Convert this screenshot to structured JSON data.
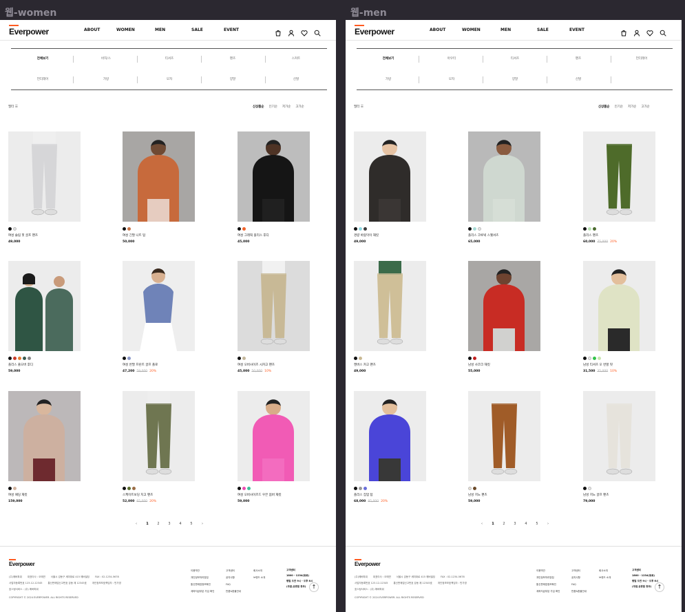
{
  "frames": [
    {
      "label": "웹-women",
      "categories_row1": [
        "전체보기",
        "바지/스",
        "티셔츠",
        "팬츠",
        "스커트"
      ],
      "categories_row2": [
        "언더레어",
        "가방",
        "모자",
        "양말",
        "신발"
      ],
      "products": [
        {
          "name": "여성 슬림 핏 골프 팬츠",
          "price": "49,000",
          "orig": "",
          "disc": "",
          "colors": [
            "#111111",
            "#e3e3e3"
          ],
          "bg": "#ececec",
          "fig": "pants",
          "c1": "#d6d6d8",
          "c2": "#efefef",
          "skin": "#e9c7a9"
        },
        {
          "name": "여성 긴팔 니트 탑",
          "price": "50,000",
          "orig": "",
          "disc": "",
          "colors": [
            "#111111",
            "#c8764a"
          ],
          "bg": "#a8a6a4",
          "fig": "top",
          "c1": "#c76a3c",
          "c2": "#e6ccc0",
          "skin": "#6f4a34"
        },
        {
          "name": "여성 그래픽 플리스 후디",
          "price": "45,000",
          "orig": "",
          "disc": "",
          "colors": [
            "#111111",
            "#f2632a"
          ],
          "bg": "#bdbdbd",
          "fig": "top",
          "c1": "#151515",
          "c2": "#202020",
          "skin": "#4e3325"
        },
        {
          "name": "플리스 풀오버 후디",
          "price": "59,000",
          "orig": "",
          "disc": "",
          "colors": [
            "#111111",
            "#c93b2b",
            "#e57e33",
            "#3a5a4e",
            "#888888"
          ],
          "bg": "#ececec",
          "fig": "duo",
          "c1": "#2f5544",
          "c2": "#23302c",
          "skin": "#d9b596"
        },
        {
          "name": "여성 반팔 프린트 골프 폴로",
          "price": "47,200",
          "orig": "59,000",
          "disc": "20%",
          "colors": [
            "#111111",
            "#8a98c8"
          ],
          "bg": "#eeeeee",
          "fig": "polo",
          "c1": "#6f83b8",
          "c2": "#ffffff",
          "skin": "#d8b090"
        },
        {
          "name": "여성 오버사이즈 시카고 팬츠",
          "price": "45,000",
          "orig": "50,000",
          "disc": "10%",
          "colors": [
            "#111111",
            "#c4b79c"
          ],
          "bg": "#dcdcdc",
          "fig": "pants",
          "c1": "#c8b996",
          "c2": "#f1f1f1",
          "skin": "#4e3325"
        },
        {
          "name": "여성 패딩 재킷",
          "price": "159,000",
          "orig": "",
          "disc": "",
          "colors": [
            "#111111",
            "#d4b6a2"
          ],
          "bg": "#bcb8b9",
          "fig": "top",
          "c1": "#cdb0a0",
          "c2": "#6e2a2f",
          "skin": "#d9b79d"
        },
        {
          "name": "스케이트보딩 치고 팬츠",
          "price": "52,000",
          "orig": "65,000",
          "disc": "20%",
          "colors": [
            "#111111",
            "#5a6d2e",
            "#9b6d46"
          ],
          "bg": "#ececec",
          "fig": "pants",
          "c1": "#6f7651",
          "c2": "#eeeeee",
          "skin": "#b98462"
        },
        {
          "name": "여성 오버사이즈드 우븐 봄버 재킷",
          "price": "59,000",
          "orig": "",
          "disc": "",
          "colors": [
            "#111111",
            "#ea4bb0",
            "#3fbf9a"
          ],
          "bg": "#ececec",
          "fig": "top",
          "c1": "#f15bb5",
          "c2": "#f36cbf",
          "skin": "#d8ac88"
        }
      ]
    },
    {
      "label": "웹-men",
      "categories_row1": [
        "전체보기",
        "아우터",
        "티셔츠",
        "팬츠",
        "언더레어"
      ],
      "categories_row2": [
        "가방",
        "모자",
        "양말",
        "신발",
        ""
      ],
      "products": [
        {
          "name": "경량 바람막이 재킷",
          "price": "49,000",
          "orig": "",
          "disc": "",
          "colors": [
            "#111111",
            "#8fd8e2",
            "#3c3c3c"
          ],
          "bg": "#ececec",
          "fig": "top",
          "c1": "#2f2c2a",
          "c2": "#3a3634",
          "skin": "#e6c3a4"
        },
        {
          "name": "플리스 크루넥 스웻셔츠",
          "price": "65,000",
          "orig": "",
          "disc": "",
          "colors": [
            "#111111",
            "#a9dcd7",
            "#e8e8e8"
          ],
          "bg": "#b9b9b9",
          "fig": "top",
          "c1": "#cfd8d0",
          "c2": "#d6ded6",
          "skin": "#8a5b3f"
        },
        {
          "name": "플리스 팬츠",
          "price": "60,000",
          "orig": "75,000",
          "disc": "20%",
          "colors": [
            "#111111",
            "#b8e2b2",
            "#4d6b30"
          ],
          "bg": "#ececec",
          "fig": "pants",
          "c1": "#4e6b2a",
          "c2": "#ececec",
          "skin": "#6f4a34"
        },
        {
          "name": "캔버스 카고 팬츠",
          "price": "49,000",
          "orig": "",
          "disc": "",
          "colors": [
            "#111111",
            "#c9b993"
          ],
          "bg": "#ececec",
          "fig": "pants",
          "c1": "#cfbf98",
          "c2": "#3b6b4a",
          "skin": "#e1b896"
        },
        {
          "name": "남성 사코크 재킷",
          "price": "55,000",
          "orig": "",
          "disc": "",
          "colors": [
            "#111111",
            "#c21f1f"
          ],
          "bg": "#a9a7a5",
          "fig": "top",
          "c1": "#c82c24",
          "c2": "#d1d1cf",
          "skin": "#6e4330"
        },
        {
          "name": "남성 티셔츠 오 번할 핏",
          "price": "31,500",
          "orig": "35,000",
          "disc": "10%",
          "colors": [
            "#111111",
            "#e8e8e8",
            "#33c24a",
            "#c8e6b0"
          ],
          "bg": "#ececec",
          "fig": "top",
          "c1": "#dfe3c5",
          "c2": "#2a2a2a",
          "skin": "#e3bf9c"
        },
        {
          "name": "플리스 집업 탑",
          "price": "68,000",
          "orig": "85,000",
          "disc": "20%",
          "colors": [
            "#111111",
            "#999999",
            "#6a6fd8"
          ],
          "bg": "#ececec",
          "fig": "top",
          "c1": "#4a45d8",
          "c2": "#383838",
          "skin": "#e3bf9c"
        },
        {
          "name": "남성 치노 팬츠",
          "price": "59,000",
          "orig": "",
          "disc": "",
          "colors": [
            "#e8e0d2",
            "#6b4a2a"
          ],
          "bg": "#ececec",
          "fig": "pants",
          "c1": "#a05c28",
          "c2": "#ececec",
          "skin": "#d8b090"
        },
        {
          "name": "남성 치노 골프 팬츠",
          "price": "79,000",
          "orig": "",
          "disc": "",
          "colors": [
            "#111111",
            "#e8e8e8"
          ],
          "bg": "#ececec",
          "fig": "pants",
          "c1": "#e6e3dc",
          "c2": "#ececec",
          "skin": "#d8b090"
        }
      ]
    }
  ],
  "header": {
    "logo": "Everpower",
    "nav": [
      "ABOUT",
      "WOMEN",
      "MEN",
      "SALE",
      "EVENT"
    ]
  },
  "filter_label": "필터 ☰",
  "sort_options": [
    "신상품순",
    "인기순",
    "저가순",
    "고가순"
  ],
  "pagination": {
    "prev": "‹",
    "pages": [
      "1",
      "2",
      "3",
      "4",
      "5"
    ],
    "next": "›"
  },
  "footer": {
    "logo": "Everpower",
    "info_line1": [
      "(주)에버파워",
      "대표이사 : 오에연",
      "서울시 강동구 세미대로 415 에버빌딩",
      "FAX : 02-1234-5678"
    ],
    "info_line2": [
      "사업자등록번호 123-12-12345",
      "통신판매업신고번호 강동 제 12345호",
      "개인정보보호책임자 : 민가영"
    ],
    "info_line3": [
      "호스팅서비스 : (주) 에버파워"
    ],
    "copyright": "COPYRIGHT © 2024 EVERPOWER. ALL RIGHTS RESERVED",
    "col1": [
      "이용약관",
      "개인정보처리방침",
      "통신판매업정보확인",
      "계좌지급부분 가입 확인"
    ],
    "col2": [
      "고객센터",
      "공지사항",
      "FAQ",
      "반품&환불안내"
    ],
    "col3": [
      "회사소개",
      "브랜드 소개"
    ],
    "cs_title": "고객센터",
    "cs_phone": "1800 - 1234(유료)",
    "cs_hours": "평일 오전 9시 - 오후 6시",
    "cs_note": "(주말,공휴일 휴무)",
    "top_button": "↑"
  },
  "colors": {
    "accent": "#ff5a1f",
    "dark_bg": "#2b2830"
  }
}
